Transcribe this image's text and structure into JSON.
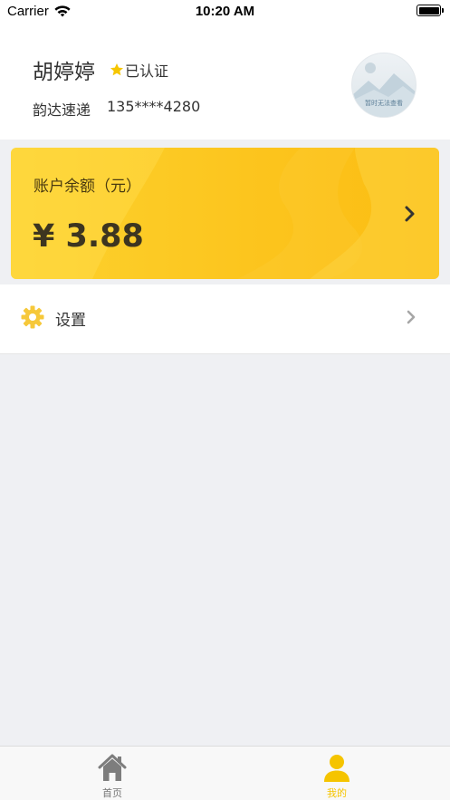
{
  "status_bar": {
    "carrier": "Carrier",
    "time": "10:20 AM",
    "icons": [
      "wifi-icon",
      "battery-icon"
    ]
  },
  "profile": {
    "name": "胡婷婷",
    "verified_label": "已认证",
    "company": "韵达速递",
    "phone": "135****4280",
    "avatar_placeholder_text": "暂时无法查看",
    "icons": [
      "star-icon",
      "avatar-placeholder-image"
    ]
  },
  "balance": {
    "label": "账户余额（元）",
    "amount": "¥ 3.88",
    "icons": [
      "chevron-right-icon"
    ]
  },
  "settings": {
    "label": "设置",
    "icons": [
      "gear-icon",
      "chevron-right-icon"
    ]
  },
  "tab_bar": {
    "tabs": [
      {
        "label": "首页",
        "icon": "home-icon",
        "active": false
      },
      {
        "label": "我的",
        "icon": "user-icon",
        "active": true
      }
    ]
  },
  "colors": {
    "accent": "#fcc51e",
    "active_tab": "#f5c400",
    "background": "#eff0f3"
  }
}
